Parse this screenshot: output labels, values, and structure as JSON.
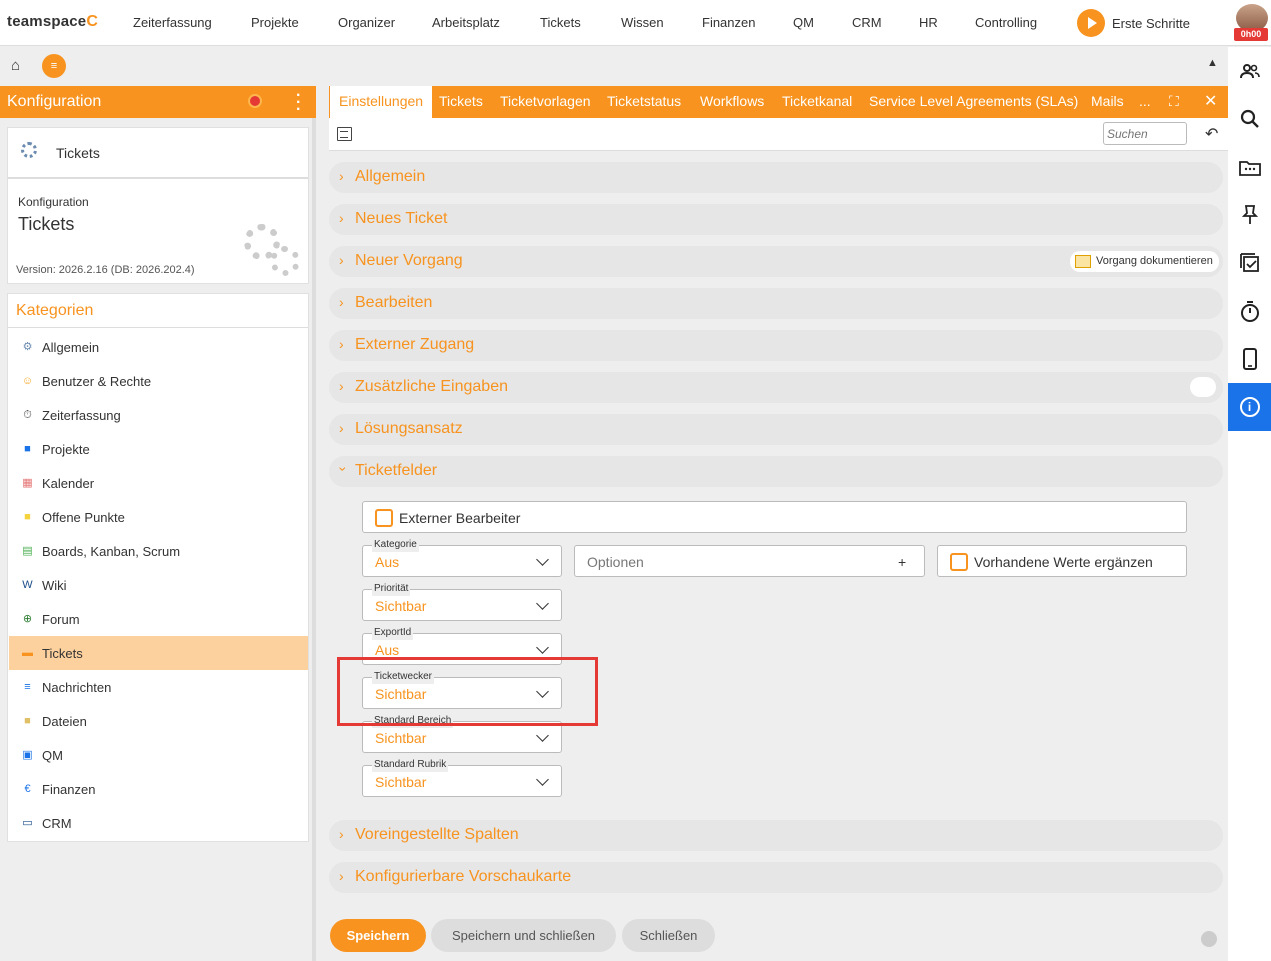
{
  "topnav": {
    "logo_text": "teamspace",
    "logo_mark": "C",
    "items": [
      "Zeiterfassung",
      "Projekte",
      "Organizer",
      "Arbeitsplatz",
      "Tickets",
      "Wissen",
      "Finanzen",
      "QM",
      "CRM",
      "HR",
      "Controlling"
    ],
    "erste_schritte": "Erste Schritte",
    "timer_badge": "0h00"
  },
  "bar2": {
    "home_icon": "⌂",
    "menu_icon": "≡",
    "collapse_icon": "▲"
  },
  "left": {
    "header_title": "Konfiguration",
    "card": {
      "item_label": "Tickets",
      "section_label": "Konfiguration",
      "title": "Tickets",
      "version": "Version: 2026.2.16 (DB: 2026.202.4)"
    },
    "categories_title": "Kategorien",
    "categories": [
      {
        "label": "Allgemein",
        "icon": "gear-icon",
        "glyph": "⚙",
        "color": "#6b8bb0"
      },
      {
        "label": "Benutzer & Rechte",
        "icon": "users-icon",
        "glyph": "☺",
        "color": "#f5a623"
      },
      {
        "label": "Zeiterfassung",
        "icon": "stopwatch-icon",
        "glyph": "⏱",
        "color": "#555555"
      },
      {
        "label": "Projekte",
        "icon": "folder-icon",
        "glyph": "■",
        "color": "#1a73e8"
      },
      {
        "label": "Kalender",
        "icon": "calendar-icon",
        "glyph": "▦",
        "color": "#e57373"
      },
      {
        "label": "Offene Punkte",
        "icon": "sticky-note-icon",
        "glyph": "■",
        "color": "#f5d33d"
      },
      {
        "label": "Boards, Kanban, Scrum",
        "icon": "board-icon",
        "glyph": "▤",
        "color": "#4caf50"
      },
      {
        "label": "Wiki",
        "icon": "wiki-icon",
        "glyph": "W",
        "color": "#1a4e8a"
      },
      {
        "label": "Forum",
        "icon": "forum-icon",
        "glyph": "⊕",
        "color": "#2e7d32"
      },
      {
        "label": "Tickets",
        "icon": "ticket-icon",
        "glyph": "▬",
        "color": "#f7931e"
      },
      {
        "label": "Nachrichten",
        "icon": "messages-icon",
        "glyph": "≡",
        "color": "#1a73e8"
      },
      {
        "label": "Dateien",
        "icon": "files-icon",
        "glyph": "■",
        "color": "#e0c168"
      },
      {
        "label": "QM",
        "icon": "qm-icon",
        "glyph": "▣",
        "color": "#1a73e8"
      },
      {
        "label": "Finanzen",
        "icon": "euro-icon",
        "glyph": "€",
        "color": "#1a73e8"
      },
      {
        "label": "CRM",
        "icon": "crm-icon",
        "glyph": "▭",
        "color": "#1a4e8a"
      }
    ],
    "active_category_index": 9
  },
  "main": {
    "tabs": [
      "Einstellungen",
      "Tickets",
      "Ticketvorlagen",
      "Ticketstatus",
      "Workflows",
      "Ticketkanal",
      "Service Level Agreements (SLAs)",
      "Mails",
      "..."
    ],
    "active_tab_index": 0,
    "search_placeholder": "Suchen",
    "sections_top": [
      "Allgemein",
      "Neues Ticket",
      "Neuer Vorgang",
      "Bearbeiten",
      "Externer Zugang",
      "Zusätzliche Eingaben",
      "Lösungsansatz",
      "Ticketfelder"
    ],
    "expanded_section": "Ticketfelder",
    "vorgang_button": "Vorgang dokumentieren",
    "ticketfelder": {
      "externer_bearbeiter": "Externer Bearbeiter",
      "kategorie": {
        "label": "Kategorie",
        "value": "Aus"
      },
      "optionen_placeholder": "Optionen",
      "optionen_add": "+",
      "vorhandene_werte": "Vorhandene Werte ergänzen",
      "prioritaet": {
        "label": "Priorität",
        "value": "Sichtbar"
      },
      "exportid": {
        "label": "ExportId",
        "value": "Aus"
      },
      "ticketwecker": {
        "label": "Ticketwecker",
        "value": "Sichtbar"
      },
      "standard_bereich": {
        "label": "Standard Bereich",
        "value": "Sichtbar"
      },
      "standard_rubrik": {
        "label": "Standard Rubrik",
        "value": "Sichtbar"
      }
    },
    "sections_bottom": [
      "Voreingestellte Spalten",
      "Konfigurierbare Vorschaukarte"
    ],
    "buttons": {
      "save": "Speichern",
      "save_close": "Speichern und schließen",
      "close": "Schließen"
    }
  },
  "colors": {
    "accent": "#f7931e",
    "highlight": "#e53935",
    "info_active": "#1a73e8"
  }
}
